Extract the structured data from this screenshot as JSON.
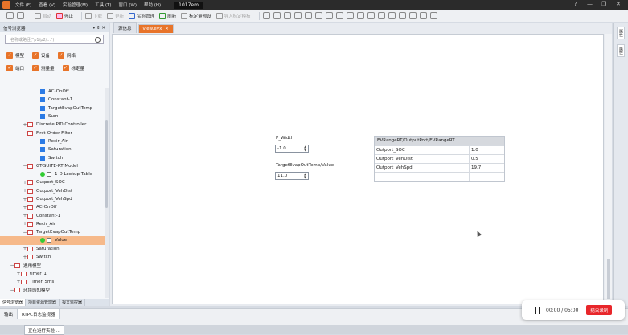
{
  "menubar": {
    "items": [
      "文件 (F)",
      "查看 (V)",
      "实验管理(M)",
      "工具 (T)",
      "窗口 (W)",
      "帮助 (H)"
    ],
    "window_title": "1017em",
    "win_controls": [
      "?",
      "—",
      "❐",
      "✕"
    ]
  },
  "toolbar": {
    "start": "启动",
    "stop": "停止",
    "download": "下载",
    "update": "更新",
    "exp_manage": "实验管理",
    "refresh": "刷新",
    "calib_preset": "标定量预设",
    "import_calib": "导入标定模板"
  },
  "left_panel": {
    "title": "信号浏览器",
    "pin": "▾ ⇕ ✕",
    "search_placeholder": "名称或路径(\"p1/p2/...\")",
    "filters_row1": [
      "模型",
      "设备",
      "网络"
    ],
    "filters_row2": [
      "端口",
      "测量量",
      "标定量"
    ],
    "tree": [
      {
        "label": "AC-OnOff",
        "indent": 1,
        "kind": "block"
      },
      {
        "label": "Constant-1",
        "indent": 1,
        "kind": "block"
      },
      {
        "label": "TargetEvapOutTemp",
        "indent": 1,
        "kind": "block"
      },
      {
        "label": "Sum",
        "indent": 1,
        "kind": "block"
      },
      {
        "label": "Discrete PID Controller",
        "indent": 0,
        "kind": "folder",
        "toggle": "+"
      },
      {
        "label": "First-Order Filter",
        "indent": 0,
        "kind": "folder",
        "toggle": "−"
      },
      {
        "label": "Recir_Air",
        "indent": 1,
        "kind": "block"
      },
      {
        "label": "Saturation",
        "indent": 1,
        "kind": "block"
      },
      {
        "label": "Switch",
        "indent": 1,
        "kind": "block"
      },
      {
        "label": "GT-SUITE-RT Model",
        "indent": 0,
        "kind": "folder",
        "toggle": "−"
      },
      {
        "label": "1-D Lookup Table",
        "indent": 1,
        "kind": "signal"
      },
      {
        "label": "Outport_SOC",
        "indent": 0,
        "kind": "folder",
        "toggle": "+"
      },
      {
        "label": "Outport_VehDist",
        "indent": 0,
        "kind": "folder",
        "toggle": "+"
      },
      {
        "label": "Outport_VehSpd",
        "indent": 0,
        "kind": "folder",
        "toggle": "+"
      },
      {
        "label": "AC-OnOff",
        "indent": 0,
        "kind": "folder",
        "toggle": "+"
      },
      {
        "label": "Constant-1",
        "indent": 0,
        "kind": "folder",
        "toggle": "+"
      },
      {
        "label": "Recir_Air",
        "indent": 0,
        "kind": "folder",
        "toggle": "+"
      },
      {
        "label": "TargetEvapOutTemp",
        "indent": 0,
        "kind": "folder",
        "toggle": "−"
      },
      {
        "label": "Value",
        "indent": 1,
        "kind": "signal",
        "selected": true
      },
      {
        "label": "Saturation",
        "indent": 0,
        "kind": "folder",
        "toggle": "+"
      },
      {
        "label": "Switch",
        "indent": 0,
        "kind": "folder",
        "toggle": "+"
      },
      {
        "label": "通用模型",
        "indent": -1,
        "kind": "folder",
        "toggle": "−"
      },
      {
        "label": "timer_1",
        "indent": -0.5,
        "kind": "folder",
        "toggle": "+"
      },
      {
        "label": "Timer_5ms",
        "indent": -0.5,
        "kind": "folder",
        "toggle": "+"
      },
      {
        "label": "环境感知模型",
        "indent": -1,
        "kind": "folder",
        "toggle": "−"
      }
    ],
    "tabs": [
      "信号浏览器",
      "项目资源管理器",
      "报文监控器"
    ]
  },
  "editor": {
    "tabs": [
      {
        "label": "源信息",
        "active": false
      },
      {
        "label": "view.evx",
        "active": true
      }
    ],
    "close_x": "✕",
    "widgets": [
      {
        "label": "P_Width",
        "value": "-1.0"
      },
      {
        "label": "TargetEvapOutTemp/Value",
        "value": "11.0"
      }
    ],
    "table": {
      "header": "EVRangeRT/OutputPort/EVRangeRT",
      "rows": [
        {
          "name": "Outport_SOC",
          "value": "1.0"
        },
        {
          "name": "Outport_VehDist",
          "value": "0.5"
        },
        {
          "name": "Outport_VehSpd",
          "value": "19.7"
        },
        {
          "name": "",
          "value": ""
        }
      ]
    }
  },
  "right_strip": {
    "tabs": [
      "属性",
      "属性"
    ]
  },
  "bottom": {
    "tabs": [
      "输出",
      "RTPC日志监视器"
    ],
    "status": "正在运行实验 ..."
  },
  "recorder": {
    "time": "00:00 / 05:00",
    "end_button": "结束录制"
  },
  "colors": {
    "accent": "#e8742a",
    "record_red": "#e8262a",
    "block_blue": "#2c7be5"
  }
}
